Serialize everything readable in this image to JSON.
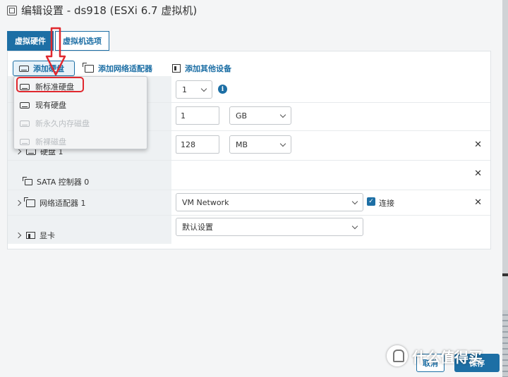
{
  "dialog": {
    "title": "编辑设置 - ds918 (ESXi 6.7 虚拟机)"
  },
  "tabs": [
    {
      "label": "虚拟硬件",
      "active": true
    },
    {
      "label": "虚拟机选项",
      "active": false
    }
  ],
  "toolbar": {
    "add_disk": "添加硬盘",
    "add_network": "添加网络适配器",
    "add_other": "添加其他设备"
  },
  "dropdown": {
    "items": [
      {
        "label": "新标准硬盘",
        "disabled": false,
        "highlighted": true
      },
      {
        "label": "现有硬盘",
        "disabled": false
      },
      {
        "label": "新永久内存磁盘",
        "disabled": true
      },
      {
        "label": "新裸磁盘",
        "disabled": true
      }
    ]
  },
  "rows": {
    "cpu": {
      "value": "1"
    },
    "memory": {
      "value": "1",
      "unit": "GB"
    },
    "disk": {
      "label": "硬盘 1",
      "value": "128",
      "unit": "MB"
    },
    "sata": {
      "label": "SATA 控制器 0"
    },
    "network": {
      "label": "网络适配器 1",
      "value": "VM Network",
      "connect_label": "连接",
      "connected": true
    },
    "video": {
      "label": "显卡",
      "value": "默认设置"
    }
  },
  "footer": {
    "cancel": "取消",
    "save": "保存"
  },
  "watermark": {
    "text": "什么值得买"
  },
  "colors": {
    "accent": "#1d6fa5",
    "annotation": "#e0282e"
  }
}
